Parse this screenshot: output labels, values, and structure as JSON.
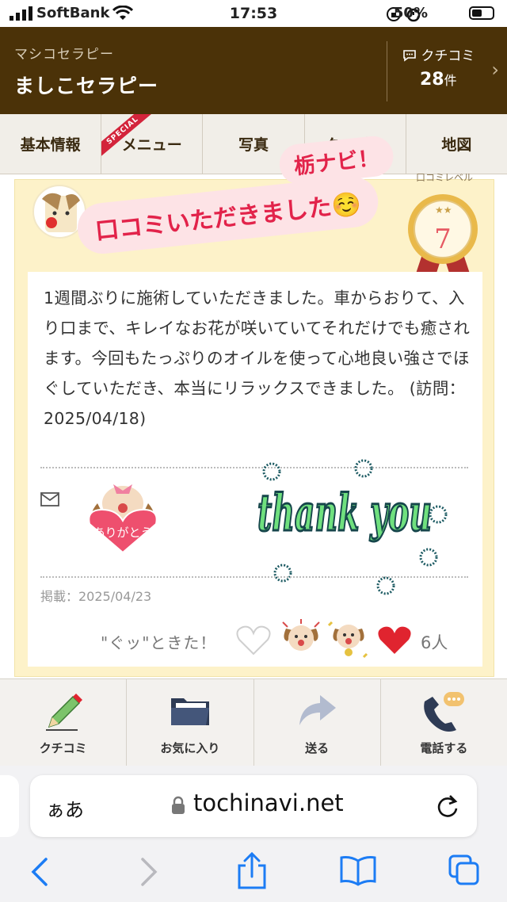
{
  "status_bar": {
    "carrier": "SoftBank",
    "time": "17:53",
    "battery": "50%"
  },
  "header": {
    "subtitle": "マシコセラピー",
    "title": "ましこセラピー",
    "kuchikomi_label": "クチコミ",
    "kuchikomi_count": "28",
    "kuchikomi_unit": "件"
  },
  "tabs": [
    {
      "label": "基本情報"
    },
    {
      "label": "メニュー",
      "badge": "SPECIAL"
    },
    {
      "label": "写真"
    },
    {
      "label": "クーポン"
    },
    {
      "label": "地図"
    }
  ],
  "overlay": {
    "line1": "栃ナビ！",
    "line2": "口コミいただきました☺️"
  },
  "review": {
    "level_label": "口コミレベル",
    "level": "7",
    "text": "1週間ぶりに施術していただきました。車からおりて、入り口まで、キレイなお花が咲いていてそれだけでも癒されます。今回もたっぷりのオイルを使って心地良い強さでほぐしていただき、本当にリラックスできました。 (訪問：2025/04/18)",
    "stamp_text": "ありがとう",
    "sticker_text": "thank you",
    "posted": "掲載：2025/04/23",
    "gut_label": "\"ぐッ\"ときた！",
    "likes": "6人"
  },
  "bottom_nav": [
    {
      "label": "クチコミ",
      "icon": "pencil-icon"
    },
    {
      "label": "お気に入り",
      "icon": "folder-icon"
    },
    {
      "label": "送る",
      "icon": "share-arrow-icon"
    },
    {
      "label": "電話する",
      "icon": "phone-icon"
    }
  ],
  "browser": {
    "aa": "ぁあ",
    "url": "tochinavi.net"
  }
}
